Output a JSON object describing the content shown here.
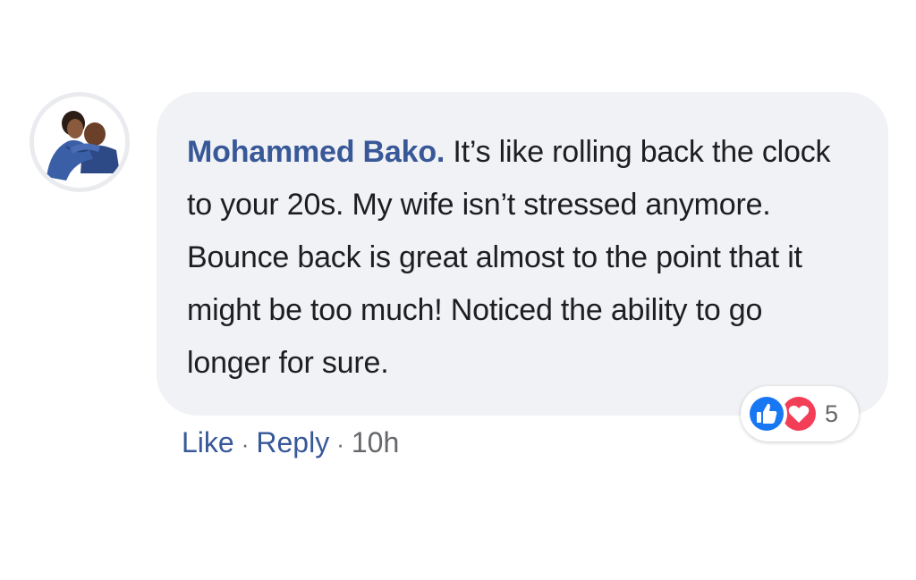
{
  "comment": {
    "author": "Mohammed Bako.",
    "text": "It’s like rolling back the clock to your 20s. My wife isn’t stressed anymore. Bounce back is great almost to the point that it might be too much! Noticed the ability to go longer for sure."
  },
  "reactions": {
    "icons": [
      "like-icon",
      "love-icon"
    ],
    "count": "5"
  },
  "actions": {
    "like_label": "Like",
    "separator": "·",
    "reply_label": "Reply",
    "timestamp": "10h"
  },
  "colors": {
    "bubble_bg": "#f0f2f5",
    "link": "#385898",
    "text": "#1c1e21",
    "meta": "#65676b",
    "like_blue": "#1877f2",
    "love_red": "#f33e58"
  }
}
